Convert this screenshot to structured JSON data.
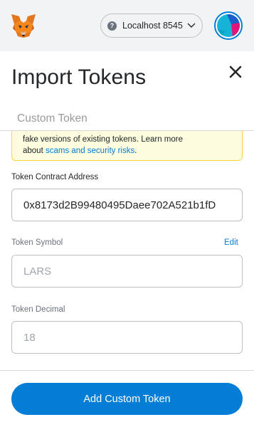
{
  "header": {
    "network": {
      "label": "Localhost 8545",
      "help_icon": "?"
    },
    "colors": {
      "header_bg": "#f2f3f4",
      "accent": "#037dd6"
    }
  },
  "page": {
    "title": "Import Tokens",
    "tabs": [
      {
        "label": "Custom Token"
      }
    ]
  },
  "warning": {
    "line1": "fake versions of existing tokens. Learn more",
    "line2_prefix": "about ",
    "link_label": "scams and security risks",
    "line2_suffix": "."
  },
  "form": {
    "contract_address": {
      "label": "Token Contract Address",
      "value": "0x8173d2B99480495Daee702A521b1fD"
    },
    "symbol": {
      "label": "Token Symbol",
      "edit_label": "Edit",
      "value": "LARS"
    },
    "decimal": {
      "label": "Token Decimal",
      "value": "18"
    }
  },
  "footer": {
    "button_label": "Add Custom Token"
  }
}
